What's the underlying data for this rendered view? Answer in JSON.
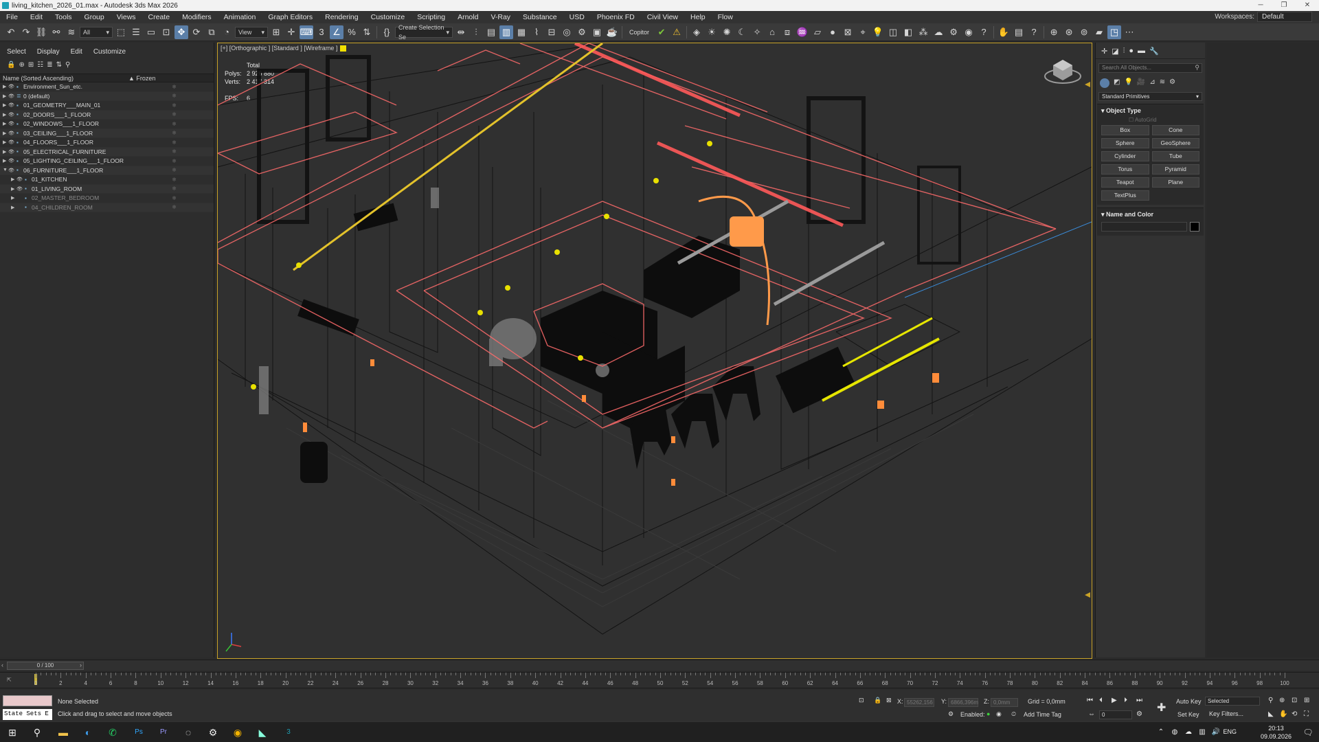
{
  "window": {
    "title": "living_kitchen_2026_01.max - Autodesk 3ds Max 2026"
  },
  "menu": [
    "File",
    "Edit",
    "Tools",
    "Group",
    "Views",
    "Create",
    "Modifiers",
    "Animation",
    "Graph Editors",
    "Rendering",
    "Customize",
    "Scripting",
    "Arnold",
    "V-Ray",
    "Substance",
    "USD",
    "Phoenix FD",
    "Civil View",
    "Help",
    "Flow"
  ],
  "workspace": {
    "label": "Workspaces:",
    "value": "Default"
  },
  "toolbar": {
    "filter_value": "All",
    "ref_coord": "View",
    "selection_set": "Create Selection Se",
    "copitor_label": "Copitor"
  },
  "scene_explorer": {
    "tabs": [
      "Select",
      "Display",
      "Edit",
      "Customize"
    ],
    "col_name": "Name (Sorted Ascending)",
    "col_frozen": "▲ Frozen",
    "rows": [
      {
        "label": "Environment_Sun_etc.",
        "indent": 0,
        "dim": false
      },
      {
        "label": "0 (default)",
        "indent": 0,
        "dim": false
      },
      {
        "label": "01_GEOMETRY___MAIN_01",
        "indent": 0,
        "dim": false
      },
      {
        "label": "02_DOORS___1_FLOOR",
        "indent": 0,
        "dim": false
      },
      {
        "label": "02_WINDOWS___1_FLOOR",
        "indent": 0,
        "dim": false
      },
      {
        "label": "03_CEILING___1_FLOOR",
        "indent": 0,
        "dim": false
      },
      {
        "label": "04_FLOORS___1_FLOOR",
        "indent": 0,
        "dim": false
      },
      {
        "label": "05_ELECTRICAL_FURNITURE",
        "indent": 0,
        "dim": false
      },
      {
        "label": "05_LIGHTING_CEILING___1_FLOOR",
        "indent": 0,
        "dim": false
      },
      {
        "label": "06_FURNITURE___1_FLOOR",
        "indent": 0,
        "dim": false
      },
      {
        "label": "01_KITCHEN",
        "indent": 1,
        "dim": false
      },
      {
        "label": "01_LIVING_ROOM",
        "indent": 1,
        "dim": false
      },
      {
        "label": "02_MASTER_BEDROOM",
        "indent": 1,
        "dim": true
      },
      {
        "label": "04_CHILDREN_ROOM",
        "indent": 1,
        "dim": true
      }
    ]
  },
  "viewport": {
    "label": "[+] [Orthographic ] [Standard ] [Wireframe ]",
    "stats": {
      "total_label": "Total",
      "polys_label": "Polys:",
      "polys": "2 926 880",
      "verts_label": "Verts:",
      "verts": "2 417 314",
      "fps_label": "FPS:",
      "fps": "6"
    }
  },
  "command_panel": {
    "search_placeholder": "Search All Objects...",
    "category": "Standard Primitives",
    "object_type_title": "Object Type",
    "autogrid": "AutoGrid",
    "primitives": [
      "Box",
      "Cone",
      "Sphere",
      "GeoSphere",
      "Cylinder",
      "Tube",
      "Torus",
      "Pyramid",
      "Teapot",
      "Plane",
      "TextPlus"
    ],
    "name_color_title": "Name and Color",
    "color_swatch": "#000000"
  },
  "time": {
    "slider": "0 / 100",
    "ticks": [
      0,
      2,
      4,
      6,
      8,
      10,
      12,
      14,
      16,
      18,
      20,
      22,
      24,
      26,
      28,
      30,
      32,
      34,
      36,
      38,
      40,
      42,
      44,
      46,
      48,
      50,
      52,
      54,
      56,
      58,
      60,
      62,
      64,
      66,
      68,
      70,
      72,
      74,
      76,
      78,
      80,
      82,
      84,
      86,
      88,
      90,
      92,
      94,
      96,
      98,
      100
    ]
  },
  "status": {
    "state_sets": "State Sets E",
    "selection": "None Selected",
    "hint": "Click and drag to select and move objects",
    "x_label": "X:",
    "x": "55262,156",
    "y_label": "Y:",
    "y": "6866,396m",
    "z_label": "Z:",
    "z": "0,0mm",
    "grid": "Grid = 0,0mm",
    "enabled": "Enabled:",
    "add_time_tag": "Add Time Tag",
    "auto_key": "Auto Key",
    "set_key": "Set Key",
    "selected": "Selected",
    "key_filters": "Key Filters...",
    "frame": "0"
  },
  "taskbar": {
    "lang": "ENG",
    "time": "20:13",
    "date": "09.09.2026"
  }
}
